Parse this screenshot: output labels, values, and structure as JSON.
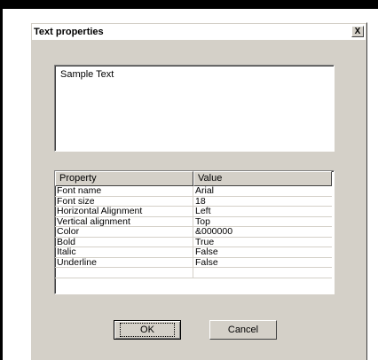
{
  "window": {
    "title": "Text properties",
    "close_label": "X"
  },
  "preview": {
    "text": "Sample Text"
  },
  "grid": {
    "headers": [
      "Property",
      "Value"
    ],
    "rows": [
      {
        "property": "Font name",
        "value": "Arial"
      },
      {
        "property": "Font size",
        "value": "18"
      },
      {
        "property": "Horizontal Alignment",
        "value": "Left"
      },
      {
        "property": "Vertical alignment",
        "value": "Top"
      },
      {
        "property": "Color",
        "value": "&000000"
      },
      {
        "property": "Bold",
        "value": "True"
      },
      {
        "property": "Italic",
        "value": "False"
      },
      {
        "property": "Underline",
        "value": "False"
      }
    ]
  },
  "buttons": {
    "ok": "OK",
    "cancel": "Cancel"
  }
}
